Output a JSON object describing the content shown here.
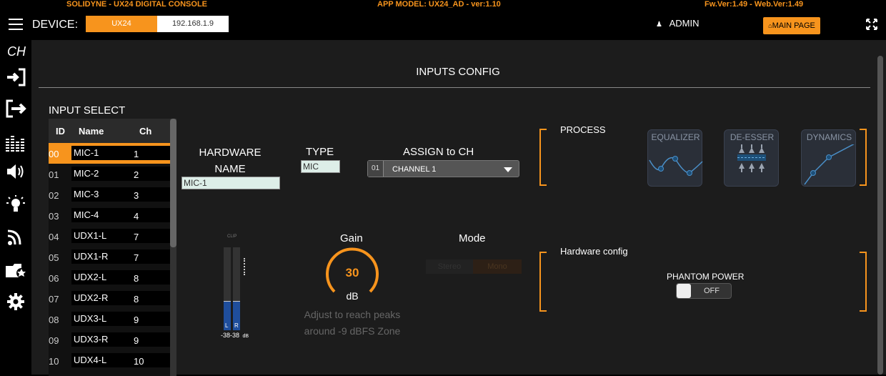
{
  "topbar": {
    "left": "SOLIDYNE - UX24 DIGITAL CONSOLE",
    "center": "APP MODEL: UX24_AD - ver:1.10",
    "right": "Fw.Ver:1.49 - Web.Ver:1.49"
  },
  "header": {
    "device_label": "DEVICE:",
    "device_name": "UX24",
    "device_ip": "192.168.1.9",
    "user": "ADMIN",
    "main_page": "MAIN PAGE"
  },
  "sidebar": {
    "section": "CH",
    "items": [
      "inputs-icon",
      "outputs-icon",
      "meters-icon",
      "speaker-icon",
      "lamp-icon",
      "rss-icon",
      "presets-icon",
      "settings-icon"
    ]
  },
  "page": {
    "title": "INPUTS CONFIG",
    "input_select": "INPUT SELECT"
  },
  "input_table": {
    "headers": [
      "ID",
      "Name",
      "Ch"
    ],
    "rows": [
      {
        "id": "00",
        "name": "MIC-1",
        "ch": "1"
      },
      {
        "id": "01",
        "name": "MIC-2",
        "ch": "2"
      },
      {
        "id": "02",
        "name": "MIC-3",
        "ch": "3"
      },
      {
        "id": "03",
        "name": "MIC-4",
        "ch": "4"
      },
      {
        "id": "04",
        "name": "UDX1-L",
        "ch": "7"
      },
      {
        "id": "05",
        "name": "UDX1-R",
        "ch": "7"
      },
      {
        "id": "06",
        "name": "UDX2-L",
        "ch": "8"
      },
      {
        "id": "07",
        "name": "UDX2-R",
        "ch": "8"
      },
      {
        "id": "08",
        "name": "UDX3-L",
        "ch": "9"
      },
      {
        "id": "09",
        "name": "UDX3-R",
        "ch": "9"
      },
      {
        "id": "10",
        "name": "UDX4-L",
        "ch": "10"
      }
    ]
  },
  "config": {
    "hw_name_label": "HARDWARE NAME",
    "hw_name_value": "MIC-1",
    "type_label": "TYPE",
    "type_value": "MIC",
    "assign_label": "ASSIGN to CH",
    "assign_num": "01",
    "assign_value": "CHANNEL 1"
  },
  "meter": {
    "clip": "CLIP",
    "left": "L",
    "right": "R",
    "value": "-38-38",
    "unit": "dB"
  },
  "gain": {
    "label": "Gain",
    "value": "30",
    "unit": "dB",
    "hint": "Adjust to reach peaks around -9 dBFS Zone"
  },
  "mode": {
    "label": "Mode",
    "stereo": "Stereo",
    "mono": "Mono"
  },
  "process": {
    "label": "PROCESS",
    "buttons": [
      "EQUALIZER",
      "DE-ESSER",
      "DYNAMICS"
    ]
  },
  "hardware": {
    "label": "Hardware config",
    "phantom_label": "PHANTOM POWER",
    "phantom_state": "OFF"
  },
  "colors": {
    "accent": "#f7941d",
    "background": "#1c1c1c",
    "meter_fill": "#1f4e9c"
  }
}
